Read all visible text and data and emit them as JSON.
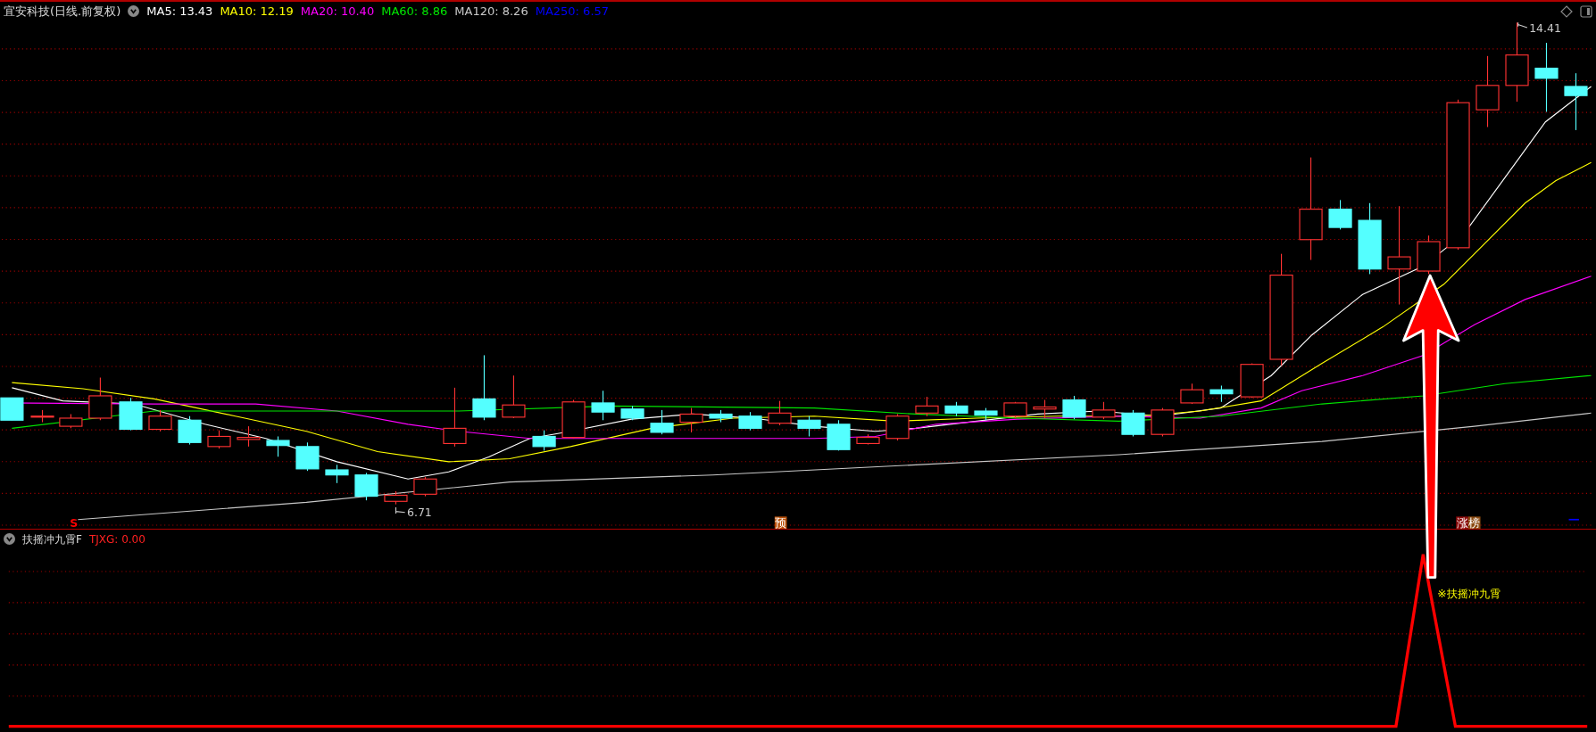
{
  "header": {
    "title": "宜安科技(日线.前复权)",
    "moving_averages": [
      {
        "label": "MA5: 13.43",
        "color": "#ffffff"
      },
      {
        "label": "MA10: 12.19",
        "color": "#ffff00"
      },
      {
        "label": "MA20: 10.40",
        "color": "#ff00ff"
      },
      {
        "label": "MA60: 8.86",
        "color": "#00e600"
      },
      {
        "label": "MA120: 8.26",
        "color": "#c8c8c8"
      },
      {
        "label": "MA250: 6.57",
        "color": "#0000ff"
      }
    ]
  },
  "price_labels": {
    "high": "14.41",
    "low": "6.71"
  },
  "markers": [
    {
      "text": "S",
      "kind": "signal",
      "color": "#ff0000"
    },
    {
      "text": "预",
      "kind": "tag",
      "color": "#b8500a"
    },
    {
      "text": "涨",
      "kind": "tag",
      "color": "#8b0a0a"
    },
    {
      "text": "榜",
      "kind": "tag",
      "color": "#8b4a10"
    }
  ],
  "indicator": {
    "name": "扶摇冲九霄F",
    "value": "TJXG: 0.00",
    "signal_label": "※扶摇冲九霄"
  }
}
